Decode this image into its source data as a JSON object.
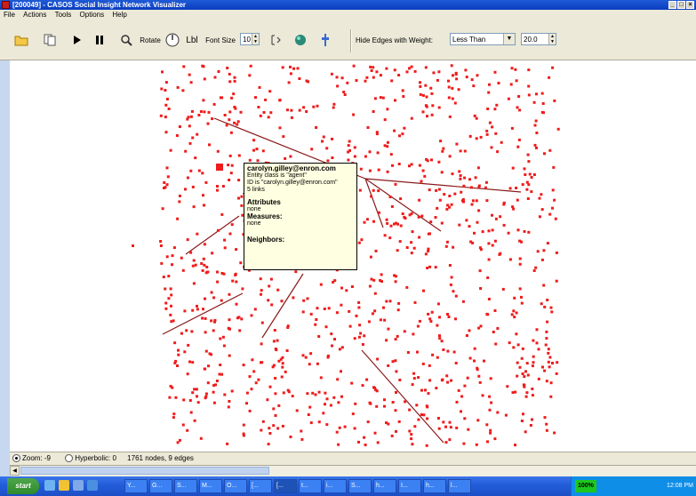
{
  "window": {
    "title": "[200049] - CASOS Social Insight Network Visualizer",
    "min": "_",
    "max": "□",
    "close": "×"
  },
  "menu": [
    "File",
    "Actions",
    "Tools",
    "Options",
    "Help"
  ],
  "toolbar": {
    "rotate_label": "Rotate",
    "lbl_label": "Lbl",
    "font_size_label": "Font Size",
    "font_size_value": "10",
    "hide_edges_label": "Hide Edges with Weight:",
    "compare_value": "Less Than",
    "weight_value": "20.0"
  },
  "popup": {
    "email": "carolyn.gilley@enron.com",
    "entity_class": "Entity class is \"agent\"",
    "id_line": "ID is \"carolyn.gilley@enron.com\"",
    "links": "5 links",
    "attributes_label": "Attributes",
    "attributes_value": "none",
    "measures_label": "Measures:",
    "measures_value": "none",
    "neighbors_label": "Neighbors:"
  },
  "status": {
    "zoom": "Zoom: -9",
    "hyperbolic": "Hyperbolic: 0",
    "counts": "1761 nodes, 9 edges"
  },
  "taskbar": {
    "start": "start",
    "tasks": [
      "Y...",
      "G...",
      "S...",
      "M...",
      "O...",
      "[...",
      "[...",
      "t...",
      "i...",
      "S...",
      "h...",
      "I...",
      "h...",
      "l..."
    ],
    "active_task_index": 6,
    "tray_percent": "100%",
    "clock": "12:08 PM"
  },
  "colors": {
    "node": "#ee1c1c",
    "edge": "#8b1a1a",
    "popup_bg": "#ffffe1",
    "titlebar": "#0a3dbf"
  }
}
